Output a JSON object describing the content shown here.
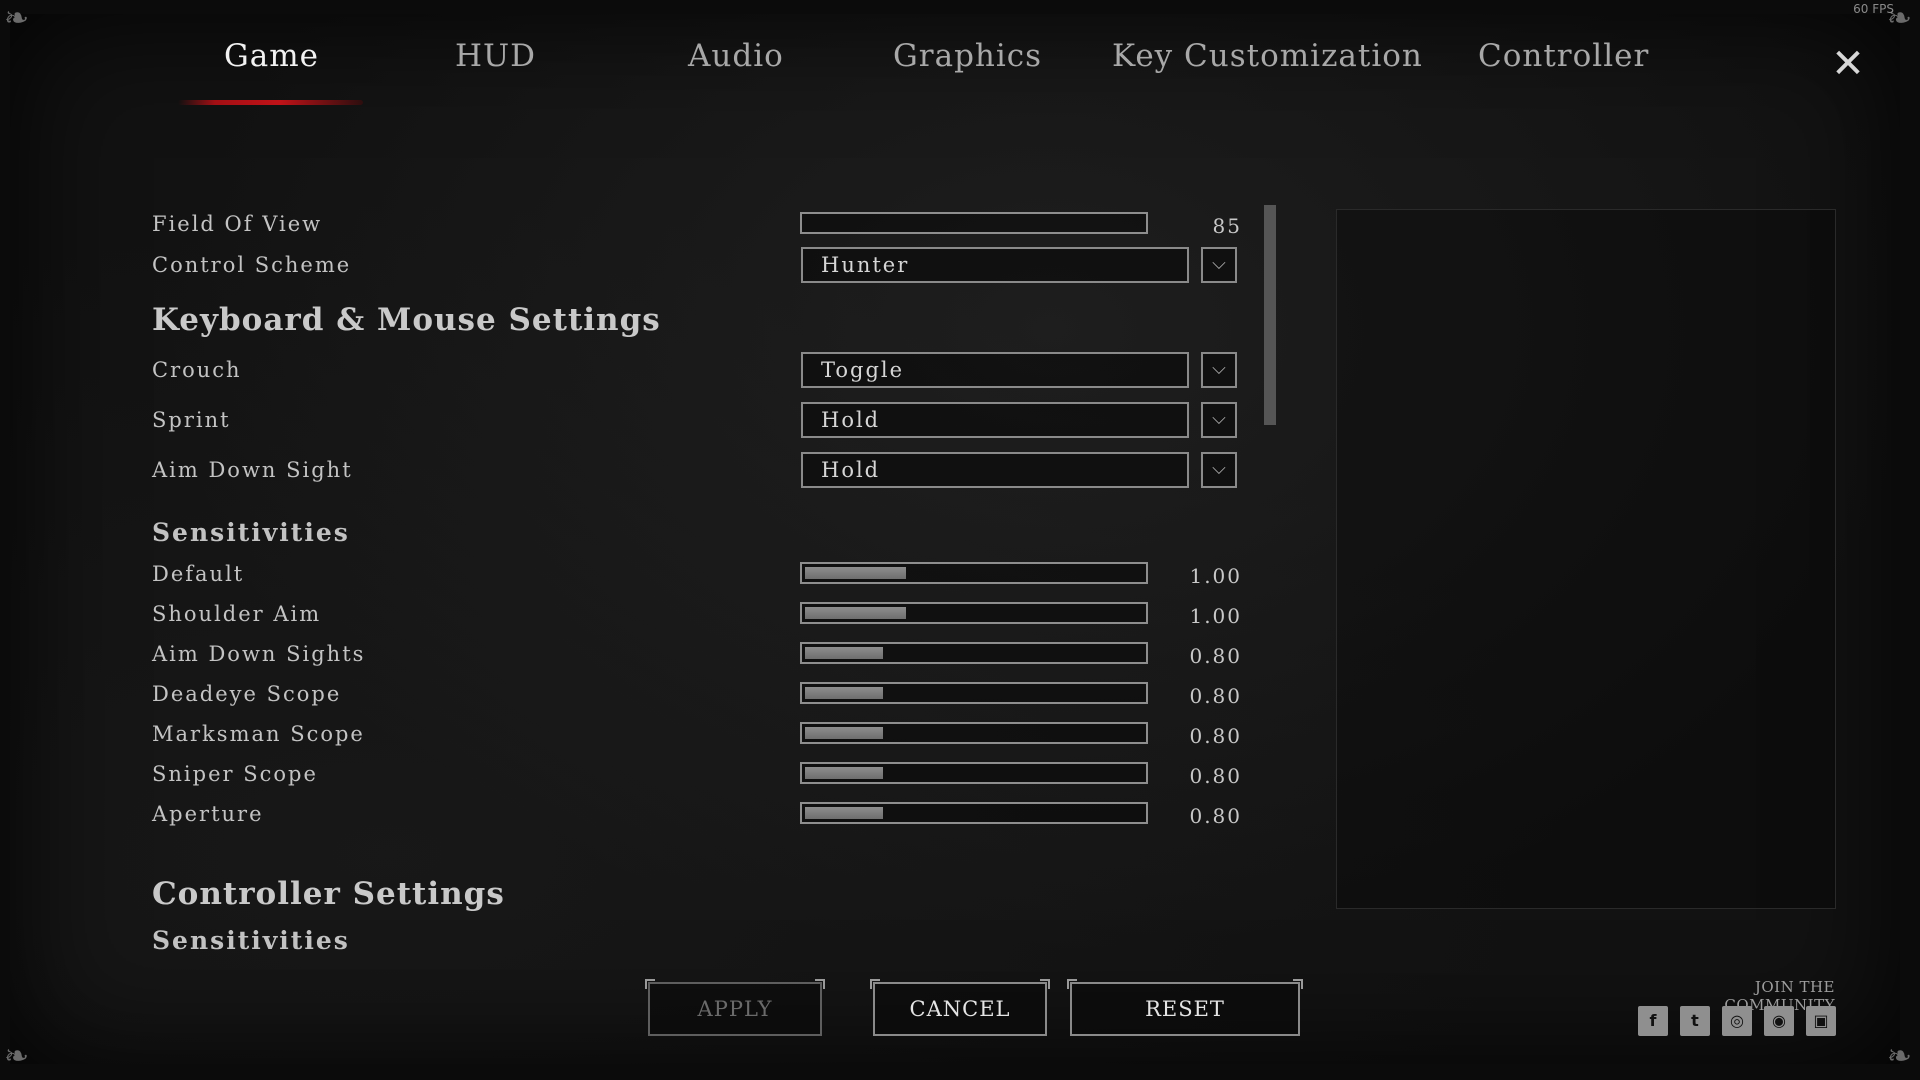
{
  "fps": "60 FPS",
  "tabs": [
    {
      "label": "Game",
      "active": true
    },
    {
      "label": "HUD"
    },
    {
      "label": "Audio"
    },
    {
      "label": "Graphics"
    },
    {
      "label": "Key Customization"
    },
    {
      "label": "Controller"
    }
  ],
  "close_icon": "close-icon",
  "general": {
    "field_of_view": {
      "label": "Field Of View",
      "value": "85",
      "level": 0.0
    },
    "control_scheme": {
      "label": "Control Scheme",
      "selected": "Hunter"
    }
  },
  "kbm": {
    "title": "Keyboard & Mouse Settings",
    "crouch": {
      "label": "Crouch",
      "selected": "Toggle"
    },
    "sprint": {
      "label": "Sprint",
      "selected": "Hold"
    },
    "ads": {
      "label": "Aim Down Sight",
      "selected": "Hold"
    },
    "sensitivities_title": "Sensitivities",
    "sensitivities": [
      {
        "label": "Default",
        "value": "1.00",
        "level": 0.3
      },
      {
        "label": "Shoulder Aim",
        "value": "1.00",
        "level": 0.3
      },
      {
        "label": "Aim Down Sights",
        "value": "0.80",
        "level": 0.23
      },
      {
        "label": "Deadeye Scope",
        "value": "0.80",
        "level": 0.23
      },
      {
        "label": "Marksman Scope",
        "value": "0.80",
        "level": 0.23
      },
      {
        "label": "Sniper Scope",
        "value": "0.80",
        "level": 0.23
      },
      {
        "label": "Aperture",
        "value": "0.80",
        "level": 0.23
      }
    ]
  },
  "controller": {
    "title": "Controller Settings",
    "sensitivities_title": "Sensitivities"
  },
  "buttons": {
    "apply": "APPLY",
    "cancel": "CANCEL",
    "reset": "RESET"
  },
  "community": {
    "label": "JOIN THE COMMUNITY",
    "icons": [
      "facebook-icon",
      "twitter-icon",
      "instagram-icon",
      "discord-icon",
      "twitch-icon"
    ]
  },
  "colors": {
    "accent": "#c01218",
    "background": "#121212",
    "text": "#c3c3c3"
  }
}
